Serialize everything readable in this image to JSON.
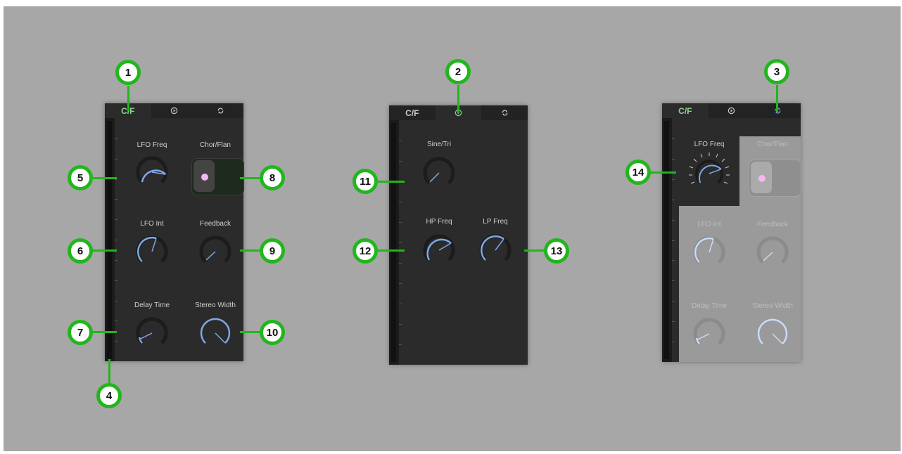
{
  "panels": [
    {
      "tabs": [
        "C/F",
        "play-circle-icon",
        "cycle-icon"
      ],
      "active_tab": 0,
      "knobs": [
        {
          "label": "LFO Freq"
        },
        {
          "label": "LFO Int"
        },
        {
          "label": "Feedback"
        },
        {
          "label": "Delay Time"
        },
        {
          "label": "Stereo Width"
        }
      ],
      "toggle_label": "Chor/Flan"
    },
    {
      "tabs": [
        "C/F",
        "play-circle-icon",
        "cycle-icon"
      ],
      "active_tab": 1,
      "knobs": [
        {
          "label": "Sine/Tri"
        },
        {
          "label": "HP Freq"
        },
        {
          "label": "LP Freq"
        }
      ]
    },
    {
      "tabs": [
        "C/F",
        "play-circle-icon",
        "cycle-icon"
      ],
      "active_tab": 2,
      "knobs": [
        {
          "label": "LFO Freq"
        },
        {
          "label": "LFO Int"
        },
        {
          "label": "Feedback"
        },
        {
          "label": "Delay Time"
        },
        {
          "label": "Stereo Width"
        }
      ],
      "toggle_label": "Chor/Flan"
    }
  ],
  "callouts": [
    "1",
    "2",
    "3",
    "4",
    "5",
    "6",
    "7",
    "8",
    "9",
    "10",
    "11",
    "12",
    "13",
    "14"
  ],
  "colors": {
    "accent_green": "#22b61d",
    "knob_blue": "#7da8e6",
    "active_tab_text": "#8fd28f",
    "toggle_dot": "#f3b7f3",
    "background": "#a7a7a7",
    "panel": "#2b2b2b"
  }
}
